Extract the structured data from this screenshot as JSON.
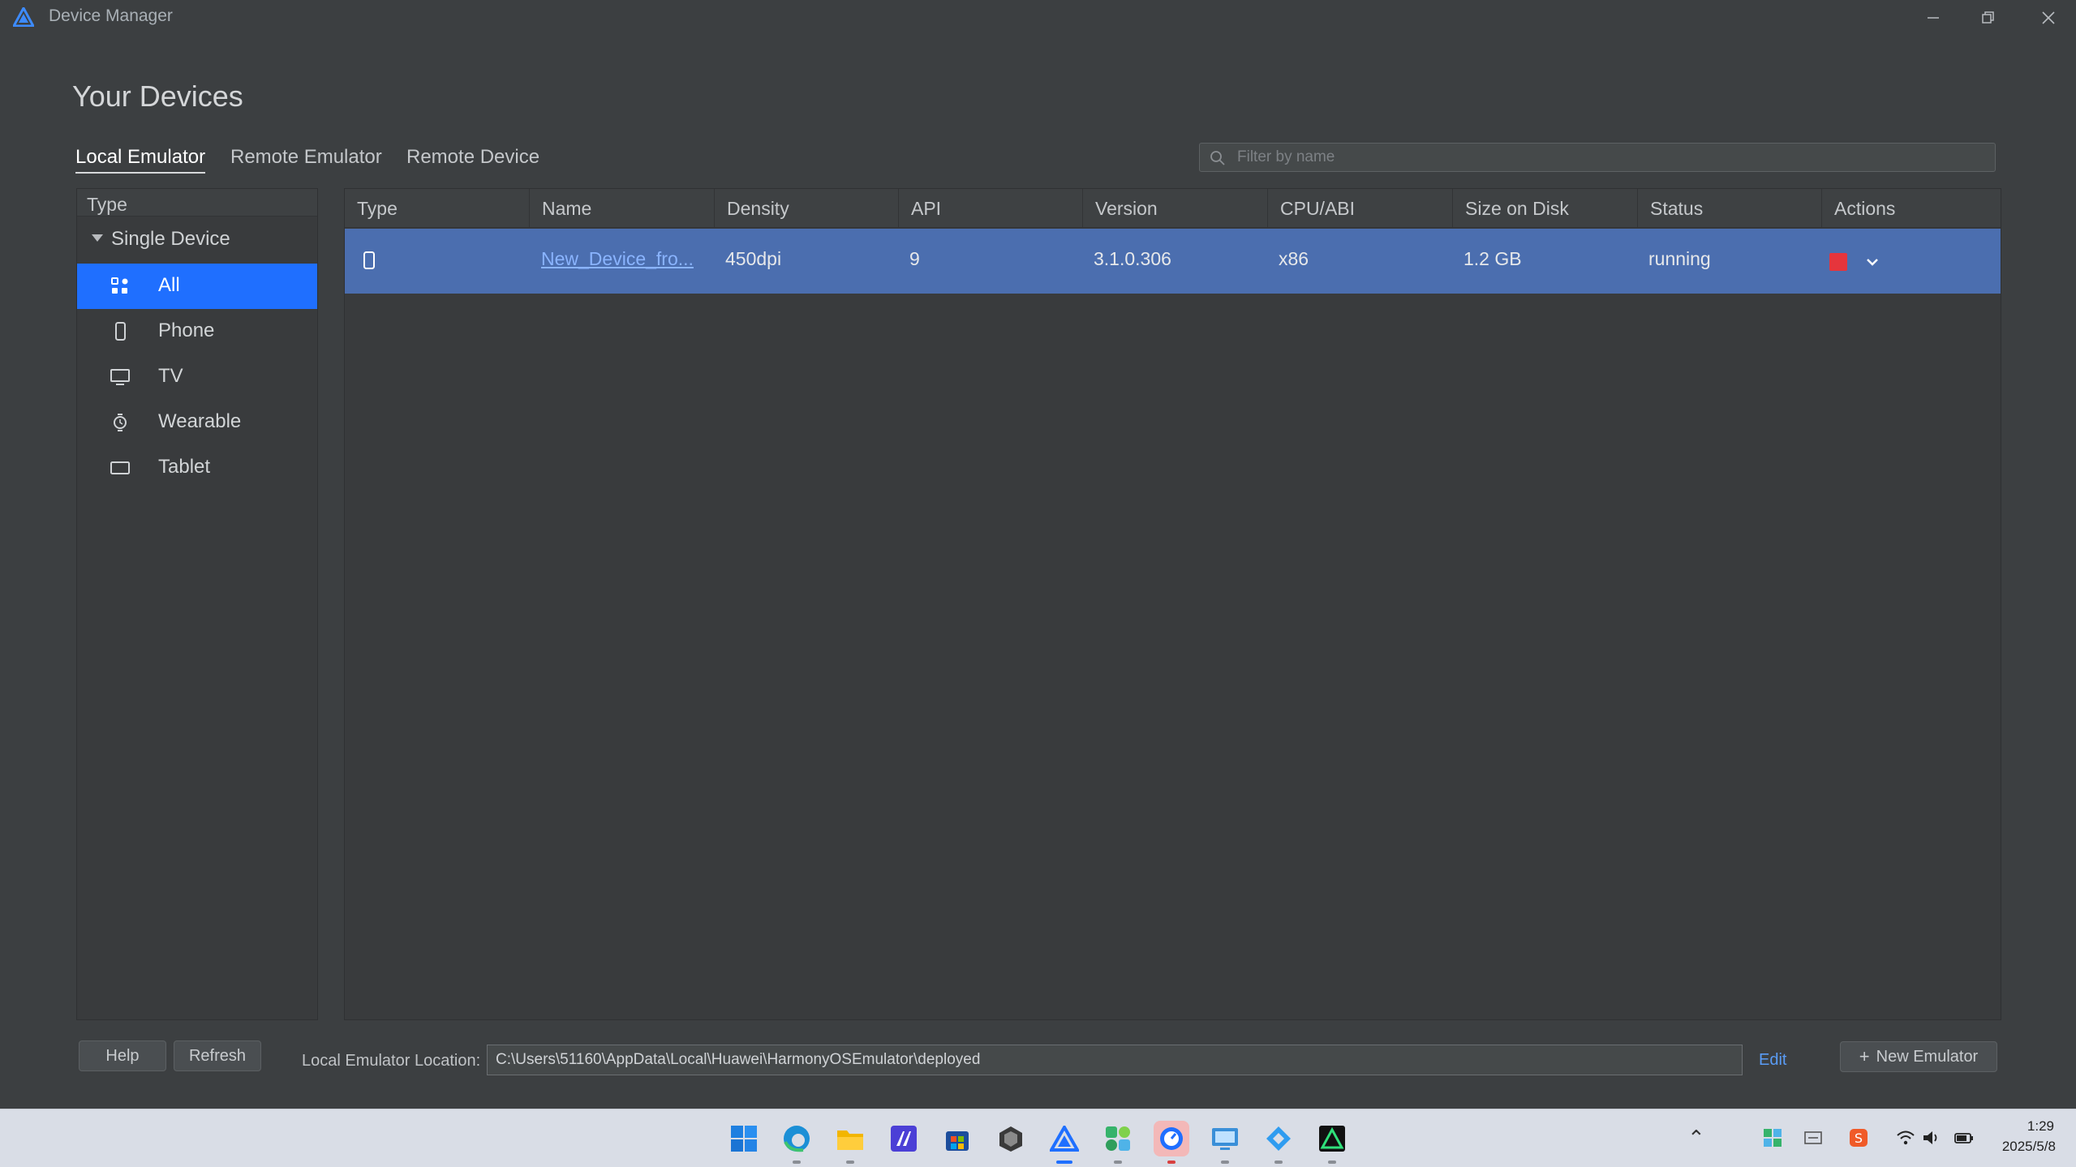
{
  "window": {
    "title": "Device Manager"
  },
  "page": {
    "title": "Your Devices"
  },
  "tabs": [
    {
      "label": "Local Emulator",
      "active": true
    },
    {
      "label": "Remote Emulator",
      "active": false
    },
    {
      "label": "Remote Device",
      "active": false
    }
  ],
  "search": {
    "placeholder": "Filter by name",
    "value": ""
  },
  "sidebar": {
    "header": "Type",
    "group": "Single Device",
    "items": [
      {
        "label": "All",
        "icon": "all-devices-icon",
        "selected": true
      },
      {
        "label": "Phone",
        "icon": "phone-icon",
        "selected": false
      },
      {
        "label": "TV",
        "icon": "tv-icon",
        "selected": false
      },
      {
        "label": "Wearable",
        "icon": "watch-icon",
        "selected": false
      },
      {
        "label": "Tablet",
        "icon": "tablet-icon",
        "selected": false
      }
    ]
  },
  "table": {
    "columns": [
      "Type",
      "Name",
      "Density",
      "API",
      "Version",
      "CPU/ABI",
      "Size on Disk",
      "Status",
      "Actions"
    ],
    "rows": [
      {
        "type_icon": "phone-icon",
        "name": "New_Device_fro...",
        "density": "450dpi",
        "api": "9",
        "version": "3.1.0.306",
        "cpu": "x86",
        "size": "1.2 GB",
        "status": "running",
        "actions": [
          "stop-icon",
          "chevron-down-icon"
        ]
      }
    ]
  },
  "footer": {
    "help": "Help",
    "refresh": "Refresh",
    "location_label": "Local Emulator Location:",
    "location_value": "C:\\Users\\51160\\AppData\\Local\\Huawei\\HarmonyOSEmulator\\deployed",
    "edit": "Edit",
    "new_emulator": "New Emulator"
  },
  "taskbar": {
    "time": "1:29",
    "date": "2025/5/8"
  },
  "colors": {
    "background": "#3c3f41",
    "selection": "#1f6fff",
    "row_selected": "#4b6eaf",
    "link": "#5a9cf6",
    "stop": "#e6353c"
  }
}
